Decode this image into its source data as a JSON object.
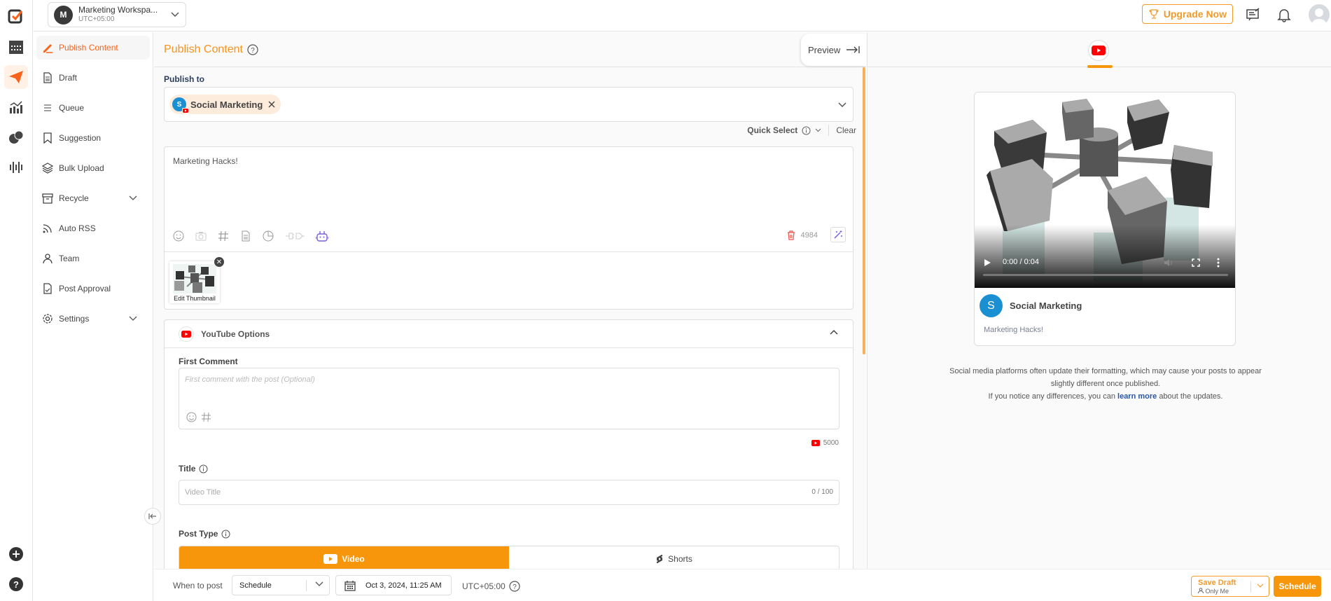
{
  "workspace": {
    "initial": "M",
    "name": "Marketing Workspa...",
    "timezone": "UTC+05:00"
  },
  "topbar": {
    "upgrade_label": "Upgrade Now"
  },
  "sidebar": {
    "items": [
      {
        "label": "Publish Content",
        "icon": "pen-icon",
        "active": true
      },
      {
        "label": "Draft",
        "icon": "document-icon"
      },
      {
        "label": "Queue",
        "icon": "list-icon"
      },
      {
        "label": "Suggestion",
        "icon": "bookmark-icon"
      },
      {
        "label": "Bulk Upload",
        "icon": "layers-icon"
      },
      {
        "label": "Recycle",
        "icon": "archive-icon",
        "expandable": true
      },
      {
        "label": "Auto RSS",
        "icon": "rss-icon"
      },
      {
        "label": "Team",
        "icon": "user-icon"
      },
      {
        "label": "Post Approval",
        "icon": "document-check-icon"
      },
      {
        "label": "Settings",
        "icon": "gear-icon",
        "expandable": true
      }
    ]
  },
  "main": {
    "title": "Publish Content",
    "preview_label": "Preview",
    "publish_to_label": "Publish to",
    "selected_account": {
      "initial": "S",
      "name": "Social Marketing",
      "platform": "YouTube"
    },
    "quick_select_label": "Quick Select",
    "clear_label": "Clear",
    "post_text": "Marketing Hacks!",
    "char_remaining": "4984",
    "thumbnail_caption": "Edit Thumbnail",
    "youtube_options": {
      "header": "YouTube Options",
      "first_comment_label": "First Comment",
      "first_comment_placeholder": "First comment with the post (Optional)",
      "first_comment_limit": "5000",
      "title_label": "Title",
      "title_placeholder": "Video Title",
      "title_count": "0 / 100",
      "post_type_label": "Post Type",
      "post_types": [
        {
          "label": "Video",
          "selected": true
        },
        {
          "label": "Shorts",
          "selected": false
        }
      ]
    }
  },
  "footer": {
    "when_label": "When to post",
    "when_value": "Schedule",
    "datetime": "Oct 3, 2024, 11:25 AM",
    "timezone": "UTC+05:00",
    "save_draft_label": "Save Draft",
    "save_draft_visibility": "Only Me",
    "schedule_label": "Schedule"
  },
  "preview": {
    "video_time": "0:00 / 0:04",
    "account_initial": "S",
    "account_name": "Social Marketing",
    "post_text": "Marketing Hacks!",
    "note_line1": "Social media platforms often update their formatting, which may cause your posts to appear slightly different once published.",
    "note_line2_pre": "If you notice any differences, you can ",
    "note_link": "learn more",
    "note_line2_post": " about the updates."
  },
  "colors": {
    "accent": "#f7960b",
    "active_nav": "#f7631b",
    "youtube": "#ff0000",
    "link": "#2957a4"
  }
}
